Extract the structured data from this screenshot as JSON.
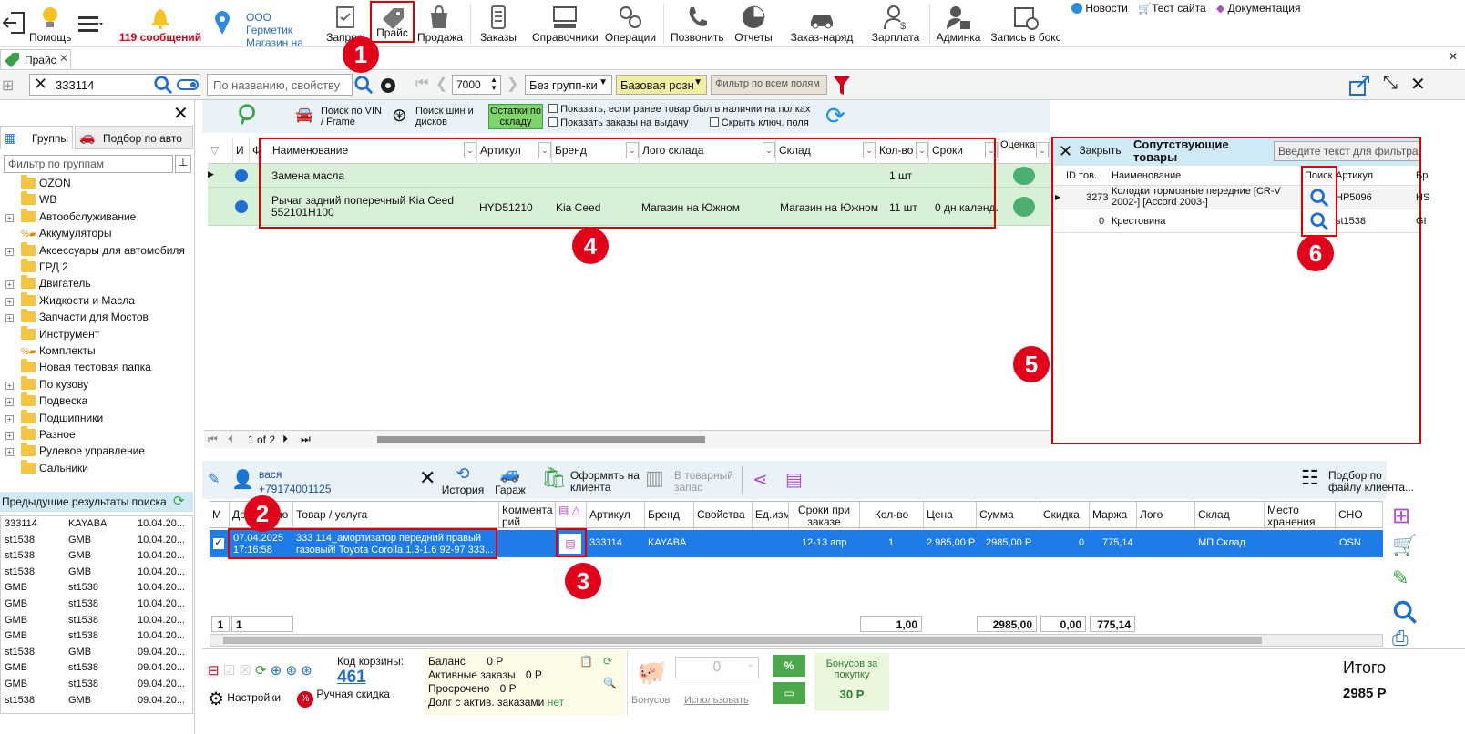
{
  "toolbar": {
    "help": "Помощь",
    "messages": "119 сообщений",
    "company_line1": "ООО Герметик",
    "company_line2": "Магазин на",
    "requests": "Запрос",
    "price": "Прайс",
    "sale": "Продажа",
    "orders": "Заказы",
    "reference": "Справочники",
    "operations": "Операции",
    "call": "Позвонить",
    "reports": "Отчеты",
    "work_order": "Заказ-наряд",
    "salary": "Зарплата",
    "admin": "Админка",
    "box_booking": "Запись в бокс",
    "news": "Новости",
    "test_site": "Тест сайта",
    "docs": "Документация"
  },
  "tab": {
    "label": "Прайс"
  },
  "filter": {
    "search_value": "333114",
    "name_placeholder": "По названию, свойству ...",
    "page_count": "7000",
    "grouping": "Без групп-ки",
    "price_type": "Базовая розн",
    "all_fields_filter": "Фильтр по всем полям"
  },
  "left": {
    "tab_groups": "Группы",
    "tab_by_car": "Подбор по авто",
    "group_filter_placeholder": "Фильтр  по группам",
    "groups": [
      {
        "name": "OZON",
        "expand": false,
        "type": "folder"
      },
      {
        "name": "WB",
        "expand": false,
        "type": "folder"
      },
      {
        "name": "Автообслуживание",
        "expand": true,
        "type": "folder"
      },
      {
        "name": "Аккумуляторы",
        "expand": false,
        "type": "percent"
      },
      {
        "name": "Аксессуары для автомобиля",
        "expand": true,
        "type": "folder"
      },
      {
        "name": "ГРД 2",
        "expand": false,
        "type": "folder"
      },
      {
        "name": "Двигатель",
        "expand": true,
        "type": "folder"
      },
      {
        "name": "Жидкости и Масла",
        "expand": true,
        "type": "folder"
      },
      {
        "name": "Запчасти для Мостов",
        "expand": true,
        "type": "folder"
      },
      {
        "name": "Инструмент",
        "expand": false,
        "type": "folder"
      },
      {
        "name": "Комплекты",
        "expand": false,
        "type": "percent"
      },
      {
        "name": "Новая тестовая папка",
        "expand": false,
        "type": "folder"
      },
      {
        "name": "По кузову",
        "expand": true,
        "type": "folder"
      },
      {
        "name": "Подвеска",
        "expand": true,
        "type": "folder"
      },
      {
        "name": "Подшипники",
        "expand": true,
        "type": "folder"
      },
      {
        "name": "Разное",
        "expand": true,
        "type": "folder"
      },
      {
        "name": "Рулевое управление",
        "expand": true,
        "type": "folder"
      },
      {
        "name": "Сальники",
        "expand": false,
        "type": "folder"
      }
    ],
    "history_title": "Предыдущие результаты поиска",
    "history": [
      [
        "333114",
        "KAYABA",
        "10.04.20..."
      ],
      [
        "st1538",
        "GMB",
        "10.04.20..."
      ],
      [
        "st1538",
        "GMB",
        "10.04.20..."
      ],
      [
        "st1538",
        "GMB",
        "10.04.20..."
      ],
      [
        "GMB",
        "st1538",
        "10.04.20..."
      ],
      [
        "GMB",
        "st1538",
        "10.04.20..."
      ],
      [
        "GMB",
        "st1538",
        "10.04.20..."
      ],
      [
        "GMB",
        "st1538",
        "10.04.20..."
      ],
      [
        "st1538",
        "GMB",
        "09.04.20..."
      ],
      [
        "GMB",
        "st1538",
        "09.04.20..."
      ],
      [
        "GMB",
        "st1538",
        "09.04.20..."
      ],
      [
        "st1538",
        "GMB",
        "09.04.20..."
      ]
    ]
  },
  "center": {
    "vin_search": "Поиск по VIN / Frame",
    "tire_search": "Поиск шин и дисков",
    "stock_btn": "Остатки по складу",
    "cb_shown_in_stock": "Показать, если ранее товар был в наличии на полках",
    "cb_show_orders": "Показать заказы на выдачу",
    "cb_hide_key": "Скрыть ключ. поля",
    "columns": [
      "И",
      "Ф",
      "Наименование",
      "Артикул",
      "Бренд",
      "Лого склада",
      "Склад",
      "Кол-во",
      "Сроки",
      "Оценка"
    ],
    "rows": [
      {
        "name": "Замена масла",
        "article": "",
        "brand": "",
        "logo": "",
        "warehouse": "",
        "qty": "1 шт",
        "term": ""
      },
      {
        "name": "Рычаг задний поперечный Kia Ceed 552101H100",
        "article": "HYD51210",
        "brand": "Kia Ceed",
        "logo": "Магазин на Южном",
        "warehouse": "Магазин на Южном",
        "qty": "11 шт",
        "term": "0 дн календ."
      }
    ],
    "pager": "1 of 2"
  },
  "related": {
    "close": "Закрыть",
    "title": "Сопутствующие товары",
    "search_placeholder": "Введите текст для фильтра...",
    "columns": [
      "ID тов.",
      "Наименование",
      "Поиск",
      "Артикул",
      "Бр"
    ],
    "rows": [
      {
        "id": "3273",
        "name": "Колодки тормозные передние [CR-V 2002-] [Accord 2003-]",
        "article": "HP5096",
        "brand": "HS"
      },
      {
        "id": "0",
        "name": "Крестовина",
        "article": "st1538",
        "brand": "GI"
      }
    ]
  },
  "cart": {
    "client_name": "вася",
    "client_phone": "+79174001125",
    "history": "История",
    "garage": "Гараж",
    "checkout": "Оформить на клиента",
    "to_stock": "В товарный запас",
    "by_file": "Подбор по файлу клиента...",
    "columns": [
      "М",
      "Добавлено",
      "Товар / услуга",
      "Коммента рий",
      "",
      "Артикул",
      "Бренд",
      "Свойства",
      "Ед.изм",
      "Сроки при заказе сейчас",
      "Кол-во",
      "Цена",
      "Сумма",
      "Скидка",
      "Маржа",
      "Лого",
      "Склад",
      "Место хранения",
      "СНО"
    ],
    "row": {
      "date": "07.04.2025",
      "time": "17:16:58",
      "product": "333 114_амортизатор передний правый газовый! Toyota Corolla 1.3-1.6 92-97 333...",
      "article": "333114",
      "brand": "KAYABA",
      "term": "12-13 апр",
      "qty": "1",
      "price": "2 985,00 Р",
      "sum": "2985,00 Р",
      "discount": "0",
      "margin": "775,14",
      "warehouse": "МП Склад",
      "sno": "OSN"
    },
    "footer": {
      "count": "1",
      "count2": "1",
      "qty": "1,00",
      "sum": "2985,00",
      "discount": "0,00",
      "margin": "775,14"
    }
  },
  "bottom": {
    "settings": "Настройки",
    "manual_discount": "Ручная скидка",
    "cart_code_label": "Код корзины:",
    "cart_code": "461",
    "balance_label": "Баланс",
    "balance": "0 Р",
    "active_orders_label": "Активные заказы",
    "active_orders": "0 Р",
    "overdue_label": "Просрочено",
    "overdue": "0 Р",
    "debt_label": "Долг с актив. заказами",
    "debt": "нет",
    "bonus_value": "0",
    "bonuses": "Бонусов",
    "use": "Использовать",
    "bonus_for_purchase": "Бонусов за покупку",
    "bonus_amount": "30 Р",
    "total_label": "Итого",
    "total": "2985 Р"
  },
  "annotations": [
    "1",
    "2",
    "3",
    "4",
    "5",
    "6"
  ]
}
